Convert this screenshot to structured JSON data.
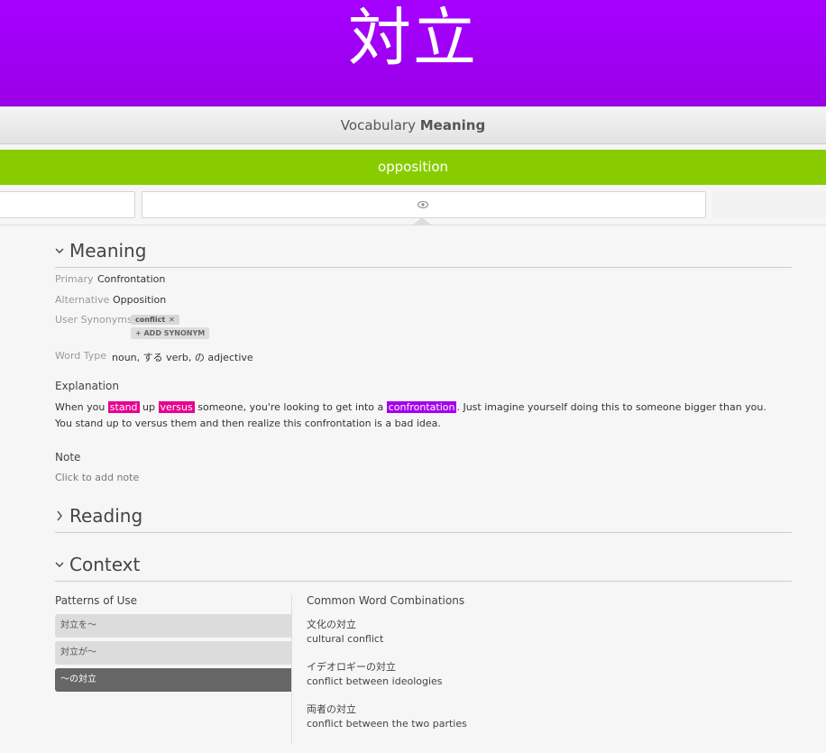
{
  "header": {
    "kanji": "対立"
  },
  "question": {
    "category": "Vocabulary",
    "type": "Meaning"
  },
  "answer": {
    "value": "opposition"
  },
  "colors": {
    "vocab": "#a500ff",
    "correct": "#88cc00",
    "highlight_radical": "#e8008f",
    "highlight_vocab": "#a400ef"
  },
  "icons": {
    "reveal": "eye-icon"
  },
  "meaning_section": {
    "title": "Meaning",
    "primary_label": "Primary",
    "primary_value": "Confrontation",
    "alternative_label": "Alternative",
    "alternative_value": "Opposition",
    "synonyms_label": "User Synonyms",
    "synonyms": [
      "conflict"
    ],
    "add_synonym": "+ ADD SYNONYM",
    "word_type_label": "Word Type",
    "word_type_value": "noun, する verb, の adjective",
    "explanation_label": "Explanation",
    "explanation": {
      "p1": "When you ",
      "h1": "stand",
      "p2": " up ",
      "h2": "versus",
      "p3": " someone, you're looking to get into a ",
      "h3": "confrontation",
      "p4": ". Just imagine yourself doing this to someone bigger than you. You stand up to versus them and then realize this confrontation is a bad idea."
    },
    "note_label": "Note",
    "note_placeholder": "Click to add note"
  },
  "reading_section": {
    "title": "Reading"
  },
  "context_section": {
    "title": "Context",
    "patterns_label": "Patterns of Use",
    "patterns": [
      "対立を〜",
      "対立が〜",
      "〜の対立"
    ],
    "combinations_label": "Common Word Combinations",
    "combinations": [
      {
        "ja": "文化の対立",
        "en": "cultural conflict"
      },
      {
        "ja": "イデオロギーの対立",
        "en": "conflict between ideologies"
      },
      {
        "ja": "両者の対立",
        "en": "conflict between the two parties"
      }
    ]
  }
}
